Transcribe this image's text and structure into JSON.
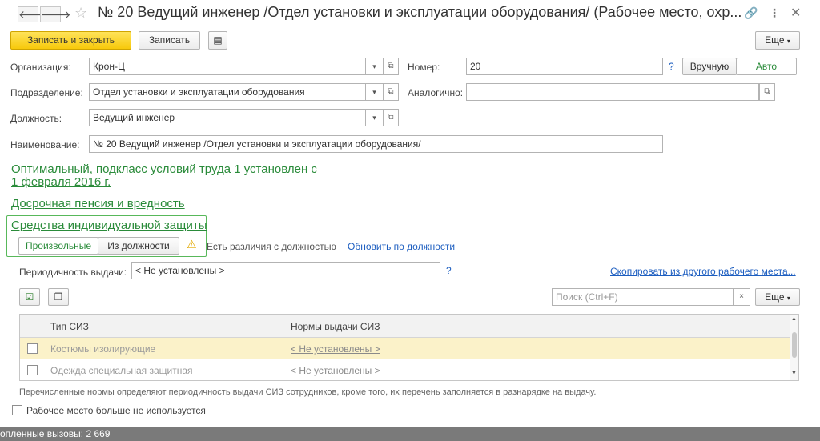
{
  "window": {
    "title": "№ 20 Ведущий инженер /Отдел установки и эксплуатации оборудования/ (Рабочее место, охр..."
  },
  "toolbar": {
    "save_close": "Записать и закрыть",
    "save": "Записать",
    "more": "Еще"
  },
  "form": {
    "org_label": "Организация:",
    "org_value": "Крон-Ц",
    "number_label": "Номер:",
    "number_value": "20",
    "manual": "Вручную",
    "auto": "Авто",
    "dept_label": "Подразделение:",
    "dept_value": "Отдел установки и эксплуатации оборудования",
    "similar_label": "Аналогично:",
    "position_label": "Должность:",
    "position_value": "Ведущий инженер",
    "name_label": "Наименование:",
    "name_value": "№ 20 Ведущий инженер /Отдел установки и эксплуатации оборудования/"
  },
  "links": {
    "optimal_line1": "Оптимальный, подкласс условий труда 1 установлен с",
    "optimal_line2": "1 февраля 2016 г.",
    "pension": "Досрочная пенсия и вредность",
    "ppe": "Средства индивидуальной защиты"
  },
  "ppe": {
    "tab_custom": "Произвольные",
    "tab_from_position": "Из должности",
    "warning": "Есть различия с должностью",
    "update_link": "Обновить по должности",
    "period_label": "Периодичность выдачи:",
    "period_value": "< Не установлены >",
    "copy_link": "Скопировать из другого рабочего места...",
    "search_placeholder": "Поиск (Ctrl+F)",
    "more": "Еще"
  },
  "table": {
    "col_type": "Тип СИЗ",
    "col_norms": "Нормы выдачи СИЗ",
    "rows": [
      {
        "type": "Костюмы изолирующие",
        "norm": "< Не установлены >"
      },
      {
        "type": "Одежда специальная защитная",
        "norm": "< Не установлены >"
      }
    ]
  },
  "footer": {
    "note": "Перечисленные нормы определяют периодичность выдачи СИЗ сотрудников, кроме того, их перечень заполняется в разнарядке на выдачу.",
    "unused_checkbox": "Рабочее место больше не используется",
    "status": "опленные вызовы: 2 669"
  },
  "colors": {
    "accent_yellow": "#f7c90b",
    "link_green": "#2a8b3a",
    "link_blue": "#1d5ec0",
    "highlight_row": "#fbf2c9"
  }
}
